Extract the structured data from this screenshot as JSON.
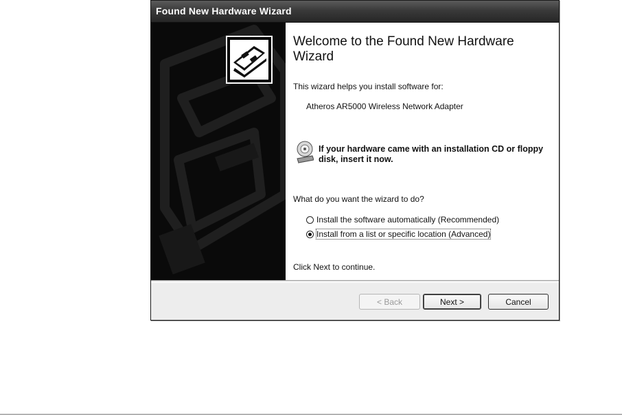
{
  "window": {
    "title": "Found New Hardware Wizard"
  },
  "content": {
    "welcome_title": "Welcome to the Found New Hardware Wizard",
    "intro": "This wizard helps you install software for:",
    "device": "Atheros AR5000 Wireless Network Adapter",
    "cd_notice": "If your hardware came with an installation CD or floppy disk, insert it now.",
    "question": "What do you want the wizard to do?",
    "options": [
      {
        "label": "Install the software automatically (Recommended)",
        "selected": false
      },
      {
        "label": "Install from a list or specific location (Advanced)",
        "selected": true
      }
    ],
    "footer_hint": "Click Next to continue."
  },
  "buttons": {
    "back": "< Back",
    "next": "Next >",
    "cancel": "Cancel"
  },
  "icons": {
    "hero": "hardware-card-icon",
    "cd": "cd-drive-icon"
  }
}
